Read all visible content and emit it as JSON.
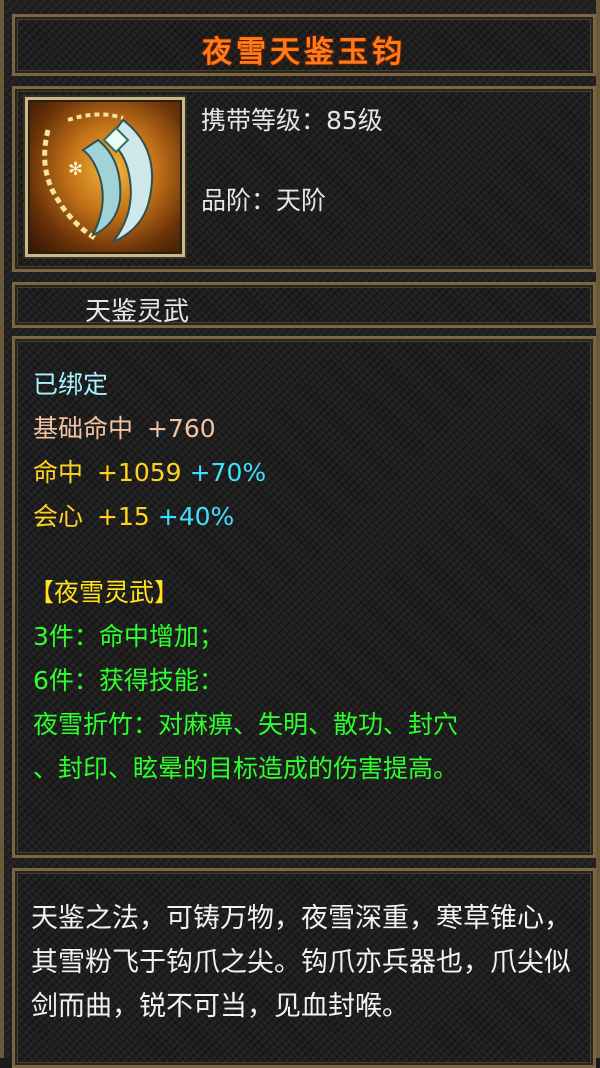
{
  "item": {
    "name": "夜雪天鉴玉钧",
    "icon": "hook-weapon-icon",
    "level_text": "携带等级：85级",
    "grade_text": "品阶：天阶",
    "category": "天鉴灵武"
  },
  "stats": {
    "bound": "已绑定",
    "base_hit_label": "基础命中",
    "base_hit_value": "+760",
    "hit_label": "命中",
    "hit_value": "+1059",
    "hit_bonus": "+70%",
    "crit_label": "会心",
    "crit_value": "+15",
    "crit_bonus": "+40%"
  },
  "set": {
    "name": "【夜雪灵武】",
    "bonus_3": "3件：命中增加；",
    "bonus_6": "6件：获得技能：",
    "skill_line1": "夜雪折竹：对麻痹、失明、散功、封穴",
    "skill_line2": "、封印、眩晕的目标造成的伤害提高。"
  },
  "description": "天鉴之法，可铸万物，夜雪深重，寒草锥心，其雪粉飞于钩爪之尖。钩爪亦兵器也，爪尖似剑而曲，锐不可当，见血封喉。",
  "colors": {
    "title": "#ff7a1a",
    "bound": "#a9f2ff",
    "base_stat": "#f2c3a2",
    "stat": "#ffd21f",
    "bonus": "#3fe0ff",
    "set_name": "#ffe21a",
    "set_text": "#2cff2c",
    "border": "#7a6642"
  }
}
